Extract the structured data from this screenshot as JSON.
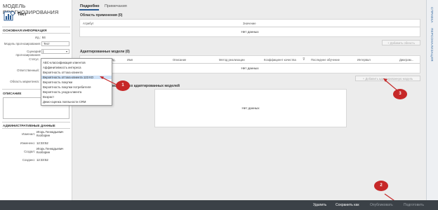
{
  "app_title": "МОДЕЛЬ ПРОГНОЗИРОВАНИЯ",
  "model_name": "Тест",
  "basic_info": {
    "header": "ОСНОВНАЯ ИНФОРМАЦИЯ",
    "id_label": "Ид.:",
    "id_value": "84",
    "model_name_label": "Модель прогнозирования:",
    "model_name_value": "Тест",
    "scenario_label": "Сценарий прогнозирования:",
    "scenario_value": "",
    "status_label": "Статус:",
    "responsible_label": "Ответственный:",
    "marketing_area_label": "Область маркетинга:"
  },
  "description": {
    "header": "ОПИСАНИЕ"
  },
  "admin": {
    "header": "АДМИНИСТРАТИВНЫЕ ДАННЫЕ",
    "changed_by_label": "Изменил:",
    "changed_by_value": "Игорь Геннадьевич Кхоборин",
    "changed_at_label": "Изменено:",
    "changed_at_value": "12:33:52",
    "created_by_label": "Создал:",
    "created_by_value": "Игорь Геннадьевич Кхоборин",
    "created_at_label": "Создано:",
    "created_at_value": "12:33:52"
  },
  "dropdown_options": [
    "ABC-классификация клиентов",
    "Аффинитивность интереса",
    "Вероятность оттока клиента",
    "Вероятность оттока клиента 123 КО",
    "Вероятность покупки",
    "Вероятность покупки потребителя",
    "Вероятность ухода клиента",
    "Возраст",
    "Демо-оценка лояльности CRM"
  ],
  "dropdown_selected_index": 3,
  "tabs": [
    "Подробно",
    "Примечания"
  ],
  "applicability": {
    "header": "Область применения (0)",
    "columns": [
      "Атрибут",
      "Значение"
    ],
    "no_data": "Нет данных",
    "add_button": "Добавить область"
  },
  "adapted": {
    "header": "Адаптированные модели (0)",
    "columns": [
      "Ид.",
      "Имя",
      "Описание",
      "Метод реализации",
      "Коэффициент качества",
      "Последнее обучение",
      "Интервал",
      "Диаграм..."
    ],
    "no_data": "Нет данных",
    "add_button": "Добавить адаптированную модель"
  },
  "selected_adapted": {
    "header": "выбранных адаптированных моделей",
    "no_data": "Нет данных"
  },
  "callouts": [
    "1",
    "2",
    "3"
  ],
  "right_tabs": [
    "СПРАВКА",
    "ПЕРСОНАЛИЗАЦИЯ"
  ],
  "bottom_buttons": {
    "delete": "Удалить",
    "save_as": "Сохранить как",
    "publish": "Опубликовать",
    "prepare": "Подготовить"
  },
  "colors": {
    "callout": "#c62828",
    "bottom_bar": "#3b4147",
    "selected": "#cfe2f7"
  }
}
